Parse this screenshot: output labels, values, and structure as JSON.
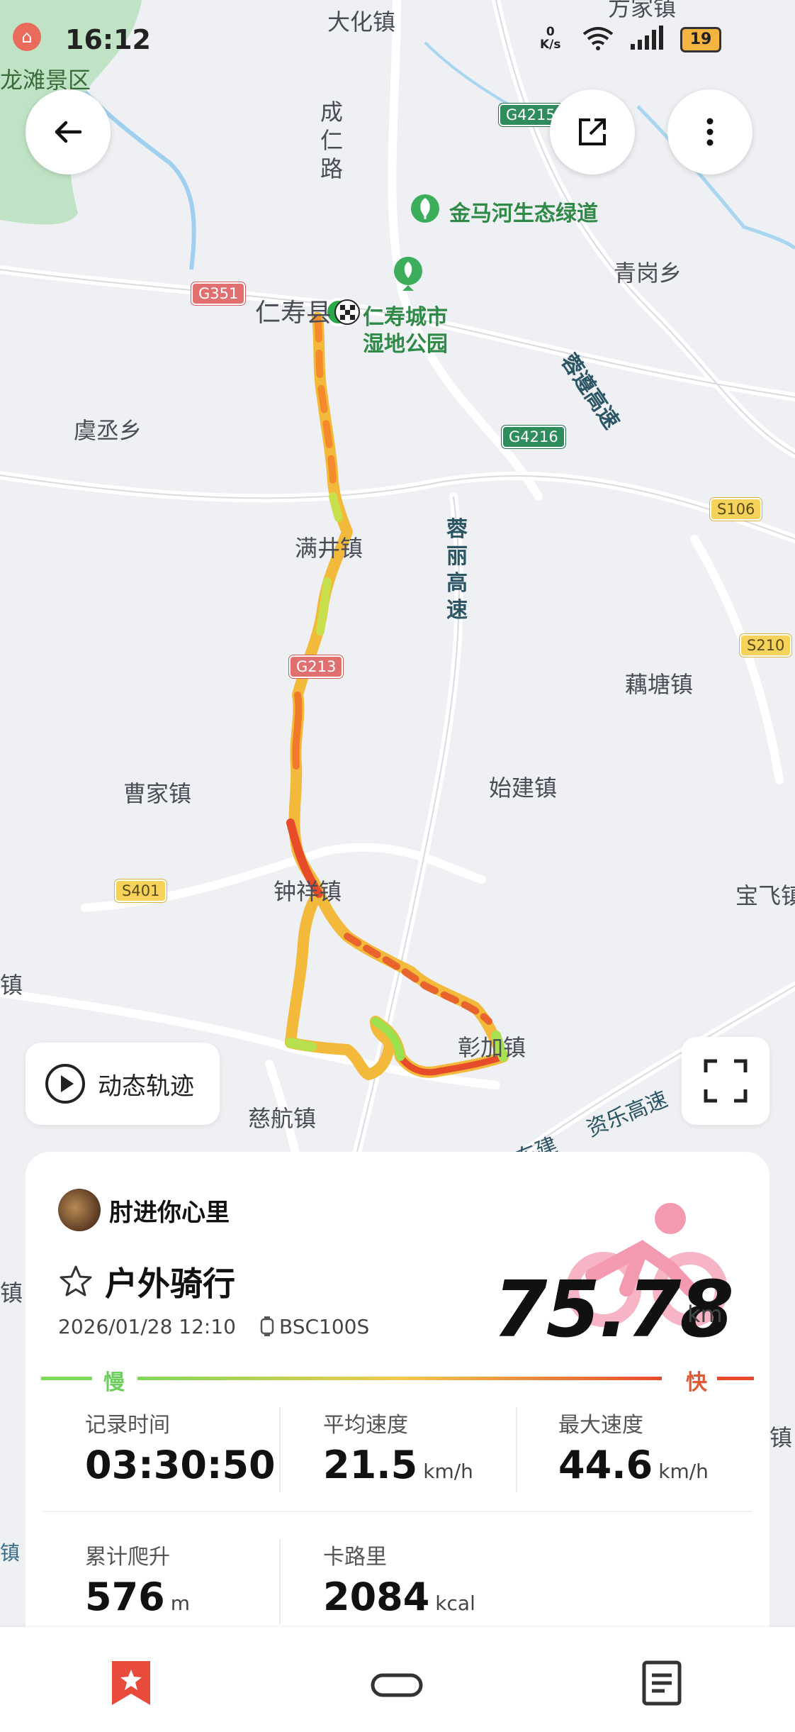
{
  "status_bar": {
    "app_icon": "map-pin-icon",
    "time": "16:12",
    "net_speed_value": "0",
    "net_speed_unit": "K/s",
    "battery": "19"
  },
  "map": {
    "place_labels": [
      "大化镇",
      "方家镇",
      "龙滩景区",
      "青岗乡",
      "虞丞乡",
      "满井镇",
      "藕塘镇",
      "曹家镇",
      "始建镇",
      "钟祥镇",
      "宝飞镇",
      "彰加镇",
      "慈航镇",
      "仁寿县",
      "镇",
      "镇",
      "镇",
      "镇"
    ],
    "road_names": {
      "chengren": "成仁路",
      "rongzun": "蓉遵高速",
      "rongli": "蓉丽高速",
      "zile": "资乐高速",
      "dongjian": "东建"
    },
    "shields": {
      "g4215": "G4215",
      "g351": "G351",
      "g4216": "G4216",
      "s106": "S106",
      "s210": "S210",
      "g213": "G213",
      "s401": "S401"
    },
    "pois": {
      "jinmahe": "金马河生态绿道",
      "renshou_park_line1": "仁寿城市",
      "renshou_park_line2": "湿地公园"
    }
  },
  "controls": {
    "playback_label": "动态轨迹",
    "back_icon": "arrow-left-icon",
    "share_icon": "share-icon",
    "more_icon": "more-vertical-icon",
    "fullscreen_icon": "fullscreen-icon"
  },
  "activity": {
    "user_name": "肘进你心里",
    "type": "户外骑行",
    "datetime": "2026/01/28 12:10",
    "device": "BSC100S",
    "distance": "75.78",
    "distance_unit": "km",
    "legend_slow": "慢",
    "legend_fast": "快",
    "stats": [
      {
        "label": "记录时间",
        "value": "03:30:50",
        "unit": ""
      },
      {
        "label": "平均速度",
        "value": "21.5",
        "unit": "km/h"
      },
      {
        "label": "最大速度",
        "value": "44.6",
        "unit": "km/h"
      },
      {
        "label": "累计爬升",
        "value": "576",
        "unit": "m"
      },
      {
        "label": "卡路里",
        "value": "2084",
        "unit": "kcal"
      }
    ]
  },
  "bottom_nav": [
    "bookmark-star-icon",
    "device-icon",
    "document-icon"
  ],
  "colors": {
    "accent_red": "#e84a3c",
    "slow_green": "#6ccf5b",
    "fast_red": "#e05a34",
    "bike_pink": "#f5a5b8"
  }
}
